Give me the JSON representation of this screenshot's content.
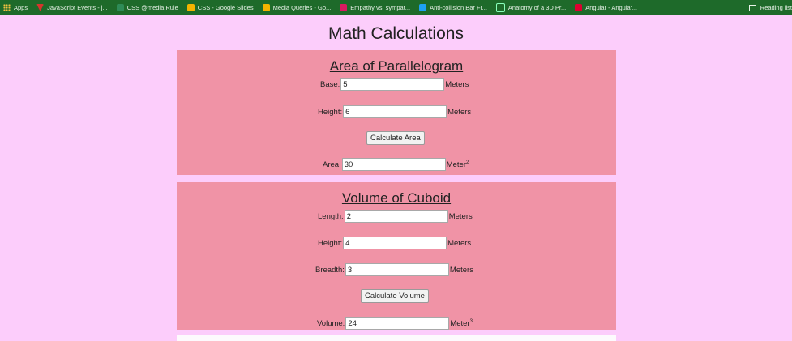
{
  "bookmarks": [
    {
      "label": "Apps",
      "icon": "apps-grid-icon"
    },
    {
      "label": "JavaScript Events - j...",
      "icon": "js-bookmark-icon"
    },
    {
      "label": "CSS @media Rule",
      "icon": "w3schools-icon"
    },
    {
      "label": "CSS - Google Slides",
      "icon": "slides-icon"
    },
    {
      "label": "Media Queries - Go...",
      "icon": "doc-icon"
    },
    {
      "label": "Empathy vs. sympat...",
      "icon": "heart-icon"
    },
    {
      "label": "Anti-collision Bar Fr...",
      "icon": "bird-icon"
    },
    {
      "label": "Anatomy of a 3D Pr...",
      "icon": "globe-icon"
    },
    {
      "label": "Angular - Angular...",
      "icon": "angular-icon"
    }
  ],
  "reading_list": "Reading list",
  "page": {
    "title": "Math Calculations"
  },
  "area": {
    "heading": "Area of Parallelogram",
    "base_label": "Base:",
    "base_value": "5",
    "base_unit": "Meters",
    "height_label": "Height:",
    "height_value": "6",
    "height_unit": "Meters",
    "button_label": "Calculate Area",
    "result_label": "Area:",
    "result_value": "30",
    "result_unit": "Meter",
    "result_exp": "2"
  },
  "volume": {
    "heading": "Volume of Cuboid",
    "length_label": "Length:",
    "length_value": "2",
    "length_unit": "Meters",
    "height_label": "Height:",
    "height_value": "4",
    "height_unit": "Meters",
    "breadth_label": "Breadth:",
    "breadth_value": "3",
    "breadth_unit": "Meters",
    "button_label": "Calculate Volume",
    "result_label": "Volume:",
    "result_value": "24",
    "result_unit": "Meter",
    "result_exp": "3"
  },
  "colors": {
    "page_background": "#fccdfb",
    "panel_background": "#f093a6",
    "bookmarks_bar": "#1e6a2a"
  }
}
